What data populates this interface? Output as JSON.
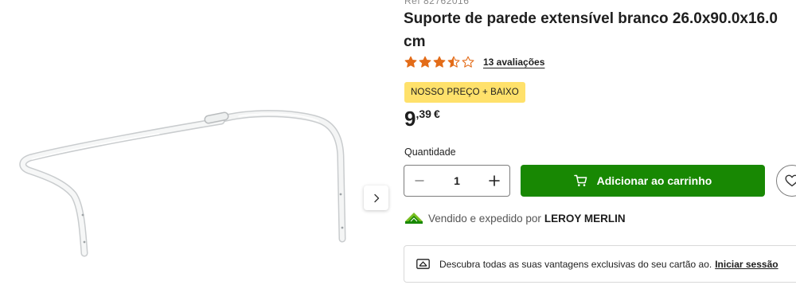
{
  "product": {
    "ref": "Ref 82762016",
    "title": "Suporte de parede extensível branco 26.0x90.0x16.0 cm",
    "rating": 3.5,
    "review_count_label": "13 avaliações",
    "badge": "NOSSO PREÇO + BAIXO",
    "price_integer": "9",
    "price_decimal": ",39",
    "currency": "€"
  },
  "purchase": {
    "quantity_label": "Quantidade",
    "quantity_value": "1",
    "add_to_cart_label": "Adicionar ao carrinho"
  },
  "seller": {
    "prefix": "Vendido e expedido por",
    "name": "LEROY MERLIN"
  },
  "banner": {
    "text": "Descubra todas as suas vantagens exclusivas do seu cartão ao.",
    "link": "Iniciar sessão"
  },
  "colors": {
    "accent_green": "#188803",
    "star_orange": "#e36c19",
    "badge_yellow": "#ffe16b"
  },
  "icons": {
    "gallery_next": "chevron-right-icon",
    "star": "star-icon",
    "cart": "cart-icon",
    "wishlist": "heart-icon",
    "seller": "leroy-merlin-logo-icon",
    "card": "card-icon",
    "minus": "minus-icon",
    "plus": "plus-icon"
  }
}
